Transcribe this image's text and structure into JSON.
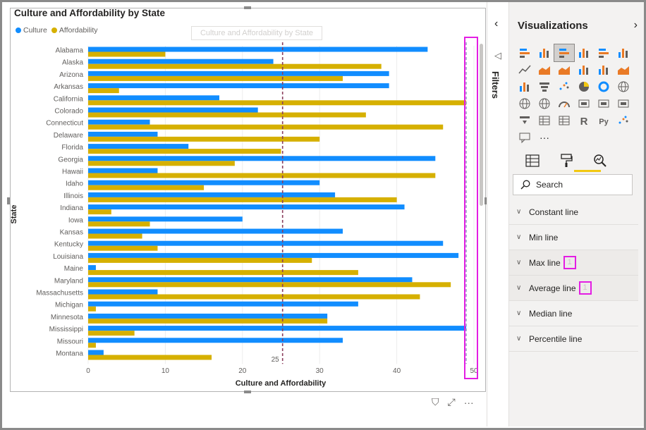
{
  "chart": {
    "title": "Culture and Affordability by State",
    "tooltip_text": "Culture and Affordability by State",
    "y_axis_title": "State",
    "x_axis_title": "Culture and Affordability",
    "reference_line_label": "25"
  },
  "chart_data": {
    "type": "bar",
    "orientation": "horizontal",
    "title": "Culture and Affordability by State",
    "xlabel": "Culture and Affordability",
    "ylabel": "State",
    "xlim": [
      0,
      50
    ],
    "x_ticks": [
      "0",
      "10",
      "20",
      "30",
      "40",
      "50"
    ],
    "grid": true,
    "legend_position": "top-left",
    "categories": [
      "Alabama",
      "Alaska",
      "Arizona",
      "Arkansas",
      "California",
      "Colorado",
      "Connecticut",
      "Delaware",
      "Florida",
      "Georgia",
      "Hawaii",
      "Idaho",
      "Illinois",
      "Indiana",
      "Iowa",
      "Kansas",
      "Kentucky",
      "Louisiana",
      "Maine",
      "Maryland",
      "Massachusetts",
      "Michigan",
      "Minnesota",
      "Mississippi",
      "Missouri",
      "Montana"
    ],
    "series": [
      {
        "name": "Culture",
        "color": "#118dff",
        "values": [
          44,
          24,
          39,
          39,
          17,
          22,
          8,
          9,
          13,
          45,
          9,
          30,
          32,
          41,
          20,
          33,
          46,
          48,
          1,
          42,
          9,
          35,
          31,
          49,
          33,
          2
        ]
      },
      {
        "name": "Affordability",
        "color": "#d6b000",
        "values": [
          10,
          38,
          33,
          4,
          49,
          36,
          46,
          30,
          25,
          19,
          45,
          15,
          40,
          3,
          8,
          7,
          9,
          29,
          35,
          47,
          43,
          1,
          31,
          6,
          1,
          16
        ]
      }
    ],
    "reference_lines": [
      {
        "type": "average",
        "value": 25.2,
        "label": "25",
        "color": "#8c3f5e"
      },
      {
        "type": "max",
        "value": 49,
        "color": "#a0a0c8"
      }
    ]
  },
  "legend": {
    "culture_label": "Culture",
    "affordability_label": "Affordability",
    "culture_color": "#118dff",
    "affordability_color": "#d6b000"
  },
  "filters": {
    "label": "Filters",
    "chevron": "‹",
    "icon": "◁"
  },
  "viz_pane": {
    "title": "Visualizations",
    "chevron": "›",
    "more_label": "···",
    "search_placeholder": "Search",
    "lines": [
      {
        "label": "Constant line",
        "count": ""
      },
      {
        "label": "Min line",
        "count": ""
      },
      {
        "label": "Max line",
        "count": "1"
      },
      {
        "label": "Average line",
        "count": "1"
      },
      {
        "label": "Median line",
        "count": ""
      },
      {
        "label": "Percentile line",
        "count": ""
      }
    ],
    "gallery_icons": [
      "stacked-bar-chart-icon",
      "stacked-column-chart-icon",
      "clustered-bar-chart-icon",
      "clustered-column-chart-icon",
      "100-stacked-bar-chart-icon",
      "100-stacked-column-chart-icon",
      "line-chart-icon",
      "area-chart-icon",
      "stacked-area-chart-icon",
      "line-and-column-chart-icon",
      "line-and-clustered-column-chart-icon",
      "ribbon-chart-icon",
      "waterfall-chart-icon",
      "funnel-chart-icon",
      "scatter-chart-icon",
      "pie-chart-icon",
      "donut-chart-icon",
      "treemap-icon",
      "map-icon",
      "filled-map-icon",
      "gauge-icon",
      "card-icon",
      "multi-row-card-icon",
      "kpi-icon",
      "slicer-icon",
      "table-icon",
      "matrix-icon",
      "r-visual-icon",
      "python-visual-icon",
      "key-influencers-icon",
      "qa-visual-icon",
      "more-visuals-icon"
    ]
  },
  "bottom_icons": {
    "filter": "⛉",
    "focus": "⤢",
    "more": "···"
  }
}
